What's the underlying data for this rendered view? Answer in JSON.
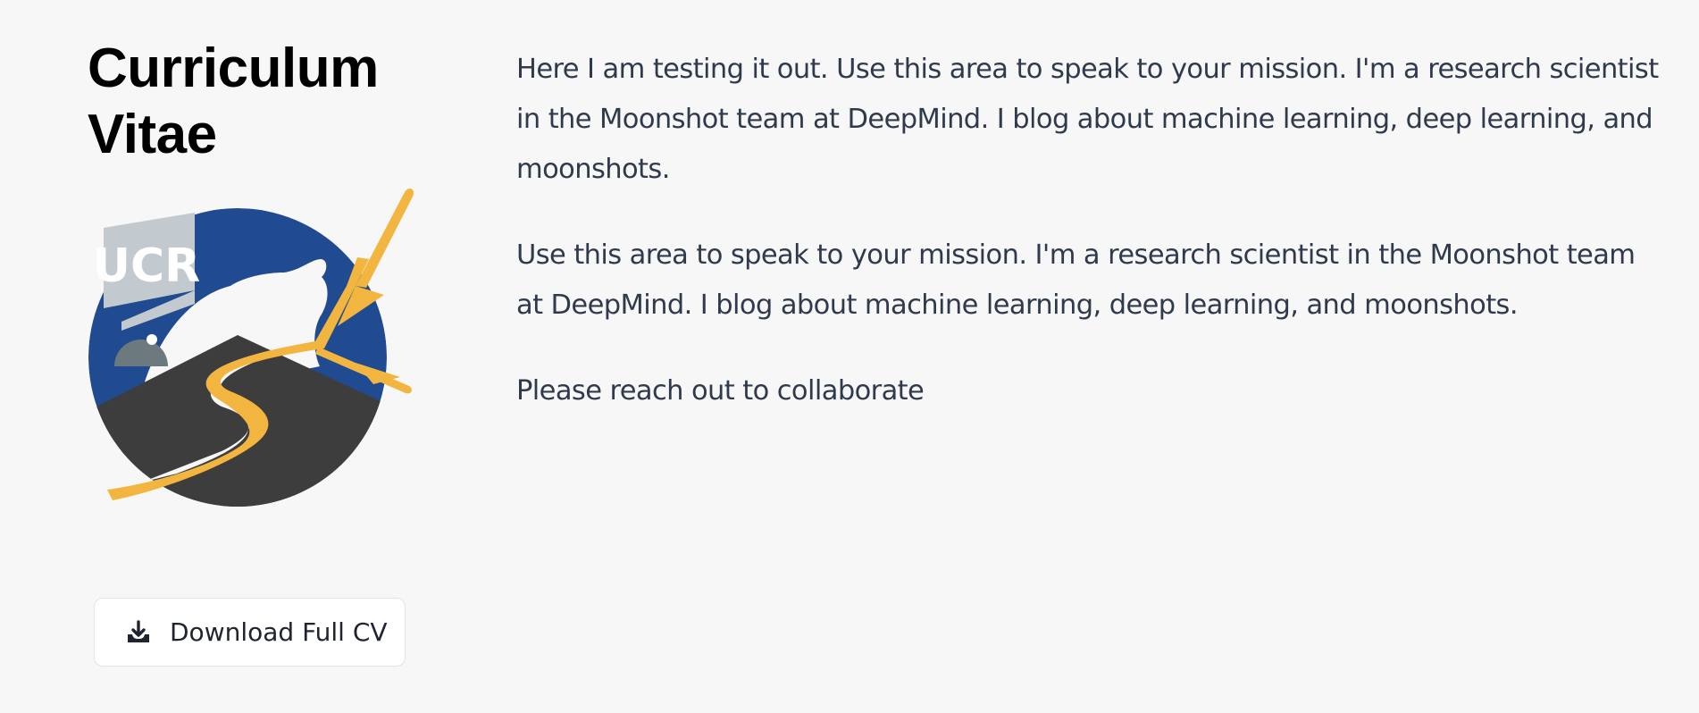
{
  "header": {
    "title_line1": "Curriculum",
    "title_line2": "Vitae"
  },
  "logo": {
    "text": "UCR",
    "colors": {
      "blue": "#214b90",
      "gold": "#f2b640",
      "dark": "#3d3d3d",
      "grey": "#c2c9cf",
      "slate": "#6c7a80"
    }
  },
  "main": {
    "paragraphs": [
      "Here I am testing it out. Use this area to speak to your mission. I'm a research scientist in the Moonshot team at DeepMind. I blog about machine learning, deep learning, and moonshots.",
      "Use this area to speak to your mission. I'm a research scientist in the Moonshot team at DeepMind. I blog about machine learning, deep learning, and moonshots.",
      "Please reach out to collaborate"
    ]
  },
  "actions": {
    "download_label": "Download Full CV",
    "download_icon": "download-icon"
  }
}
